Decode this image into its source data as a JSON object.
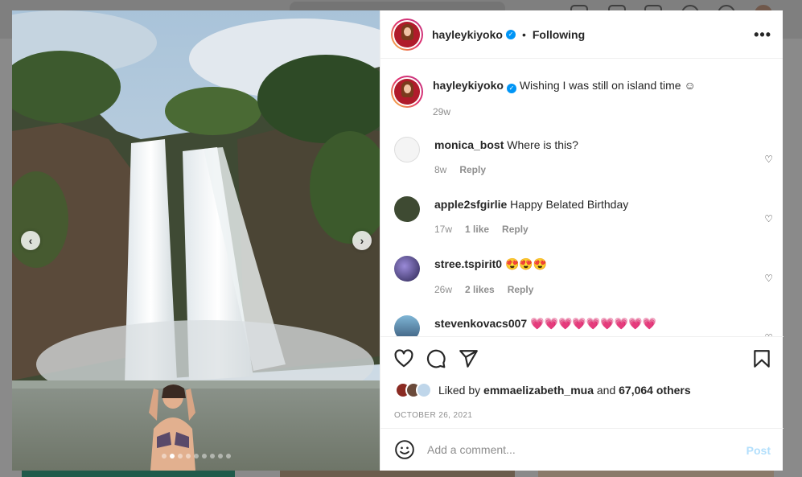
{
  "post": {
    "author": "hayleykiyoko",
    "follow_status": "Following",
    "separator": "•",
    "more_label": "•••",
    "caption": "Wishing I was still on island time ☺︎",
    "caption_age": "29w",
    "carousel": {
      "slide_count": 9,
      "active_slide": 2
    },
    "liked_by_prefix": "Liked by",
    "liked_by_user": "emmaelizabeth_mua",
    "liked_by_and": "and",
    "liked_by_others": "67,064 others",
    "date": "OCTOBER 26, 2021"
  },
  "comments": [
    {
      "user": "monica_bost",
      "text": "Where is this?",
      "age": "8w",
      "likes": "",
      "reply": "Reply"
    },
    {
      "user": "apple2sfgirlie",
      "text": "Happy Belated Birthday",
      "age": "17w",
      "likes": "1 like",
      "reply": "Reply"
    },
    {
      "user": "stree.tspirit0",
      "text": "😍😍😍",
      "age": "26w",
      "likes": "2 likes",
      "reply": "Reply"
    },
    {
      "user": "stevenkovacs007",
      "text": "💗💗💗💗💗💗💗💗💗",
      "age": "",
      "likes": "",
      "reply": ""
    }
  ],
  "comment_box": {
    "placeholder": "Add a comment...",
    "post_label": "Post"
  },
  "colors": {
    "accent": "#0095f6",
    "post_disabled": "#b2dffc",
    "muted": "#8e8e8e"
  },
  "icons": [
    "verified-badge-icon",
    "more-options-icon",
    "heart-icon",
    "comment-icon",
    "share-icon",
    "save-icon",
    "emoji-icon",
    "chevron-left-icon",
    "chevron-right-icon"
  ]
}
